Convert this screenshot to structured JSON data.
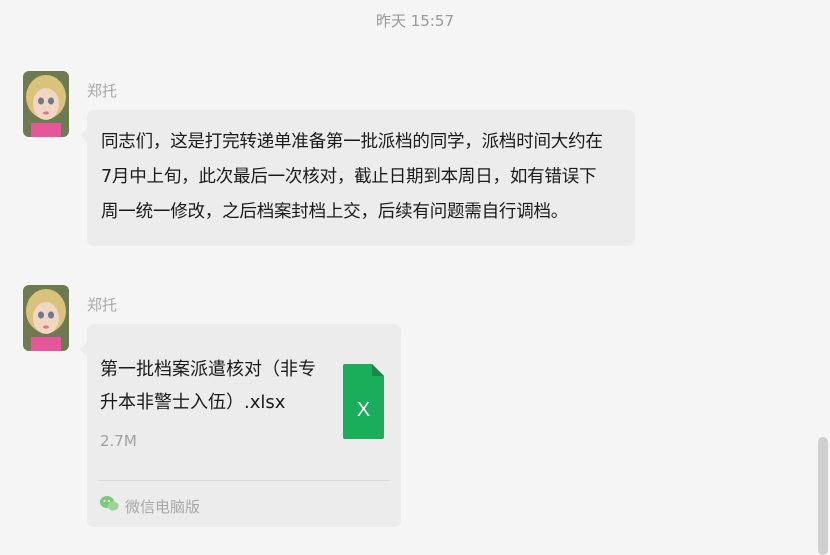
{
  "timestamp": "昨天 15:57",
  "messages": [
    {
      "sender": "郑托",
      "text_lines": [
        "同志们，这是打完转递单准备第一批派档的同学，派档时间大约在",
        "7月中上旬，此次最后一次核对，截止日期到本周日，如有错误下",
        "周一统一修改，之后档案封档上交，后续有问题需自行调档。"
      ]
    },
    {
      "sender": "郑托",
      "file": {
        "name_lines": [
          "第一批档案派遣核对（非专",
          "升本非警士入伍）.xlsx"
        ],
        "size": "2.7M",
        "icon": "excel-file-icon",
        "icon_letter": "X",
        "icon_color": "#1aad5a",
        "source": "微信电脑版",
        "source_icon": "wechat-icon"
      }
    }
  ],
  "colors": {
    "background": "#f5f5f5",
    "bubble": "#ececec",
    "muted_text": "#a8a8a8",
    "excel_green": "#1aad5a",
    "wechat_green": "#7bc97b"
  }
}
